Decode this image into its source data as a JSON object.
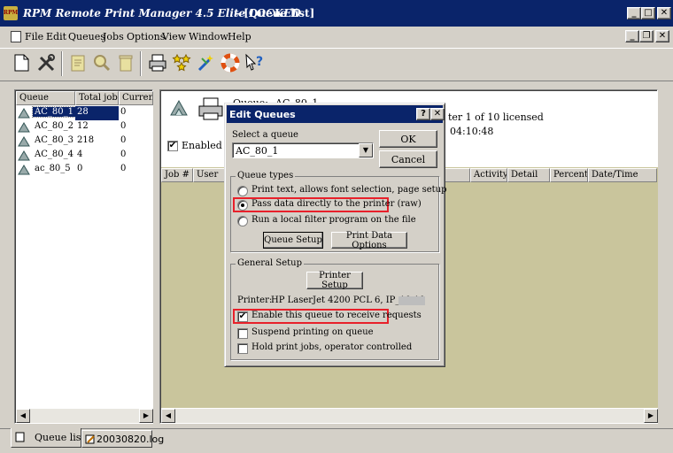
{
  "window": {
    "title": "RPM Remote Print Manager 4.5 Elite LOCKED",
    "subtitle": "- [Queue list]",
    "min": "_",
    "max": "□",
    "close": "✕",
    "child_min": "_",
    "child_restore": "❐",
    "child_close": "✕"
  },
  "menu": [
    "File",
    "Edit",
    "Queues",
    "Jobs",
    "Options",
    "View",
    "Window",
    "Help"
  ],
  "toolbar": [
    "new-icon",
    "tools-icon",
    "document-icon",
    "find-icon",
    "trash-icon",
    "printer-icon",
    "stars-icon",
    "wand-icon",
    "lifebuoy-icon",
    "help-icon"
  ],
  "queue_list": {
    "columns": [
      "Queue",
      "Total jobs",
      "Current"
    ],
    "rows": [
      {
        "name": "AC_80_1",
        "total": "28",
        "current": "0",
        "selected": true
      },
      {
        "name": "AC_80_2",
        "total": "12",
        "current": "0"
      },
      {
        "name": "AC_80_3",
        "total": "218",
        "current": "0"
      },
      {
        "name": "AC_80_4",
        "total": "4",
        "current": "0"
      },
      {
        "name": "ac_80_5",
        "total": "0",
        "current": "0"
      }
    ]
  },
  "right_pane": {
    "queue_label": "Queue:",
    "queue_value": "AC_80_1",
    "license": "ter 1 of 10 licensed",
    "time": "04:10:48",
    "enabled_label": "Enabled",
    "columns": [
      "Job #",
      "User",
      "Activity",
      "Detail",
      "Percent",
      "Date/Time"
    ]
  },
  "dialog": {
    "title": "Edit Queues",
    "help": "?",
    "close": "✕",
    "select_label": "Select a queue",
    "select_value": "AC_80_1",
    "ok": "OK",
    "cancel": "Cancel",
    "queue_types_label": "Queue types",
    "type_options": [
      "Print text, allows font selection, page setup",
      "Pass data directly to the printer (raw)",
      "Run a local filter program on the file"
    ],
    "selected_type": 1,
    "queue_setup": "Queue Setup",
    "print_data_options": "Print Data Options",
    "general_setup_label": "General Setup",
    "printer_setup": "Printer Setup",
    "printer_label": "Printer:",
    "printer_value": "HP LaserJet 4200 PCL 6, IP_10.10",
    "checkboxes": [
      {
        "label": "Enable this queue to receive requests",
        "checked": true
      },
      {
        "label": "Suspend printing on queue",
        "checked": false
      },
      {
        "label": "Hold print jobs, operator controlled",
        "checked": false
      }
    ]
  },
  "tabs": [
    "Queue list",
    "20030820.log"
  ],
  "colors": {
    "titlebar": "#0a246a",
    "selection": "#0a246a",
    "pane_bg": "#c9c59c",
    "highlight": "#e8202a"
  }
}
